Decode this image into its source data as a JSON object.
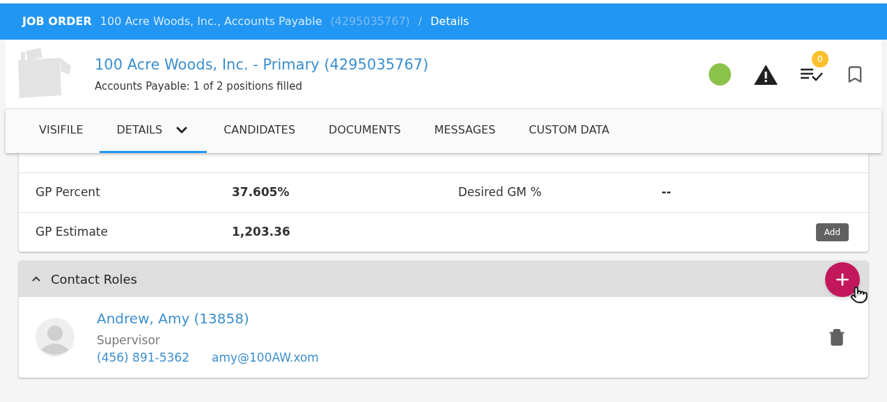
{
  "breadcrumb": {
    "section": "JOB ORDER",
    "record": "100 Acre Woods, Inc., Accounts Payable",
    "record_id": "(4295035767)",
    "separator": "/",
    "page": "Details"
  },
  "header": {
    "title": "100 Acre Woods, Inc. - Primary (4295035767)",
    "subtitle": "Accounts Payable: 1 of 2 positions filled",
    "status": {
      "color": "#8bc34a"
    },
    "tasks_badge": "0"
  },
  "tabs": [
    {
      "label": "VISIFILE",
      "selected": false,
      "dropdown": false
    },
    {
      "label": "DETAILS",
      "selected": true,
      "dropdown": true
    },
    {
      "label": "CANDIDATES",
      "selected": false,
      "dropdown": false
    },
    {
      "label": "DOCUMENTS",
      "selected": false,
      "dropdown": false
    },
    {
      "label": "MESSAGES",
      "selected": false,
      "dropdown": false
    },
    {
      "label": "CUSTOM DATA",
      "selected": false,
      "dropdown": false
    }
  ],
  "details_rows": [
    {
      "left_label": "GP Percent",
      "left_value": "37.605%",
      "right_label": "Desired GM %",
      "right_value": "--"
    },
    {
      "left_label": "GP Estimate",
      "left_value": "1,203.36"
    }
  ],
  "add_tooltip": "Add",
  "contact_roles": {
    "title": "Contact Roles",
    "expanded": true,
    "contacts": [
      {
        "name": "Andrew, Amy (13858)",
        "role": "Supervisor",
        "phone": "(456) 891-5362",
        "email": "amy@100AW.xom"
      }
    ]
  }
}
